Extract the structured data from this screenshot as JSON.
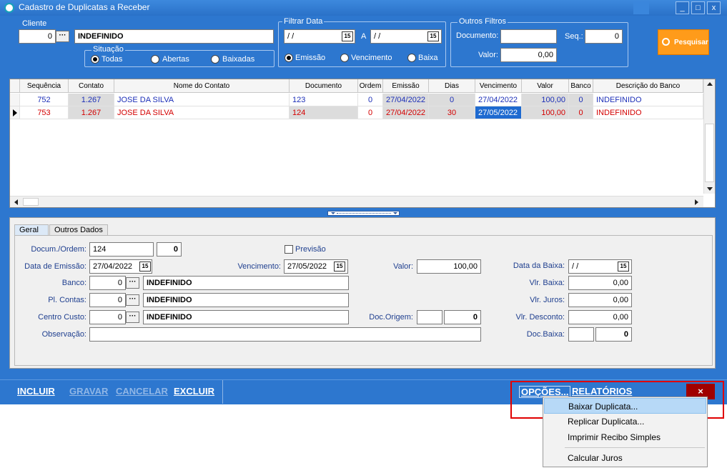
{
  "window": {
    "title": "Cadastro de Duplicatas a Receber",
    "controls": [
      "_",
      "□",
      "x"
    ]
  },
  "filters": {
    "cliente_label": "Cliente",
    "cliente_code": "0",
    "cliente_name": "INDEFINIDO",
    "situacao_label": "Situação",
    "situacao_options": [
      "Todas",
      "Abertas",
      "Baixadas"
    ],
    "filtrar_data_label": "Filtrar Data",
    "date_from": "/ /",
    "date_sep": "A",
    "date_to": "/ /",
    "date_options": [
      "Emissão",
      "Vencimento",
      "Baixa"
    ],
    "outros_filtros_label": "Outros Filtros",
    "documento_label": "Documento:",
    "documento_value": "",
    "seq_label": "Seq.:",
    "seq_value": "0",
    "valor_label": "Valor:",
    "valor_value": "0,00",
    "search_label": "Pesquisar"
  },
  "grid": {
    "columns": [
      "Sequência",
      "Contato",
      "Nome do Contato",
      "Documento",
      "Ordem",
      "Emissão",
      "Dias",
      "Vencimento",
      "Valor",
      "Banco",
      "Descrição do Banco"
    ],
    "rows": [
      {
        "cells": [
          "752",
          "1.267",
          "JOSE DA SILVA",
          "123",
          "0",
          "27/04/2022",
          "0",
          "27/04/2022",
          "100,00",
          "0",
          "INDEFINIDO"
        ],
        "color": "#1c2fb8"
      },
      {
        "cells": [
          "753",
          "1.267",
          "JOSE DA SILVA",
          "124",
          "0",
          "27/04/2022",
          "30",
          "27/05/2022",
          "100,00",
          "0",
          "INDEFINIDO"
        ],
        "color": "#d40000"
      }
    ]
  },
  "tabs": [
    "Geral",
    "Outros Dados"
  ],
  "form": {
    "docum_label": "Docum./Ordem:",
    "docum_value": "124",
    "ordem_value": "0",
    "previsao_label": "Previsão",
    "emissao_label": "Data de Emissão:",
    "emissao_value": "27/04/2022",
    "vencimento_label": "Vencimento:",
    "vencimento_value": "27/05/2022",
    "valor_label": "Valor:",
    "valor_value": "100,00",
    "data_baixa_label": "Data da Baixa:",
    "data_baixa_value": "/ /",
    "banco_label": "Banco:",
    "banco_code": "0",
    "banco_name": "INDEFINIDO",
    "vlr_baixa_label": "Vlr. Baixa:",
    "vlr_baixa_value": "0,00",
    "plcontas_label": "Pl. Contas:",
    "plcontas_code": "0",
    "plcontas_name": "INDEFINIDO",
    "vlr_juros_label": "Vlr. Juros:",
    "vlr_juros_value": "0,00",
    "centro_label": "Centro Custo:",
    "centro_code": "0",
    "centro_name": "INDEFINIDO",
    "doc_origem_label": "Doc.Origem:",
    "doc_origem_value": "0",
    "vlr_desconto_label": "Vlr. Desconto:",
    "vlr_desconto_value": "0,00",
    "observacao_label": "Observação:",
    "observacao_value": "",
    "doc_baixa_label": "Doc.Baixa:",
    "doc_baixa_value": "0"
  },
  "actions": {
    "incluir": "INCLUIR",
    "gravar": "GRAVAR",
    "cancelar": "CANCELAR",
    "excluir": "EXCLUIR",
    "opcoes": "OPÇÕES...",
    "relatorios": "RELATÓRIOS",
    "close": "×"
  },
  "menu": {
    "items": [
      "Baixar Duplicata...",
      "Replicar Duplicata...",
      "Imprimir Recibo Simples",
      "Calcular Juros"
    ]
  },
  "colors": {
    "window_blue": "#2d77cf",
    "menu_highlight": "#b7d9f7",
    "red_outline": "#e00000",
    "search_orange": "#ff9b1a",
    "row_blue": "#1c2fb8",
    "row_red": "#d40000"
  }
}
